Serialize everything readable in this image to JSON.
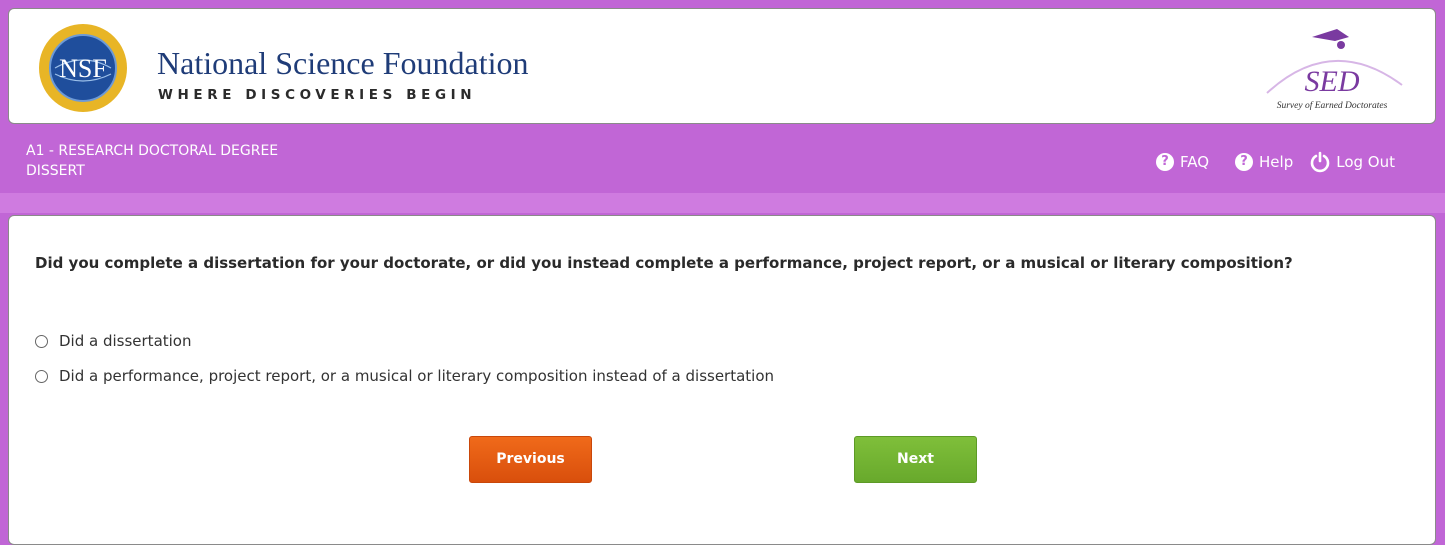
{
  "header": {
    "org_name": "National Science Foundation",
    "tagline": "WHERE DISCOVERIES BEGIN",
    "logo_text": "NSF",
    "survey_logo_text": "SED",
    "survey_logo_subtitle": "Survey of Earned Doctorates"
  },
  "section": {
    "title_line1": "A1 - RESEARCH DOCTORAL DEGREE",
    "title_line2": "DISSERT"
  },
  "nav": {
    "faq": "FAQ",
    "help": "Help",
    "logout": "Log Out"
  },
  "question": {
    "text": "Did you complete a dissertation for your doctorate, or did you instead complete a performance, project report, or a musical or literary composition?",
    "options": [
      {
        "label": "Did a dissertation",
        "selected": false
      },
      {
        "label": "Did a performance, project report, or a musical or literary composition instead of a dissertation",
        "selected": false
      }
    ]
  },
  "buttons": {
    "previous": "Previous",
    "next": "Next"
  },
  "colors": {
    "theme_purple": "#c066d6",
    "previous_orange": "#e85d13",
    "next_green": "#72b432",
    "nsf_blue": "#1f3c78"
  }
}
